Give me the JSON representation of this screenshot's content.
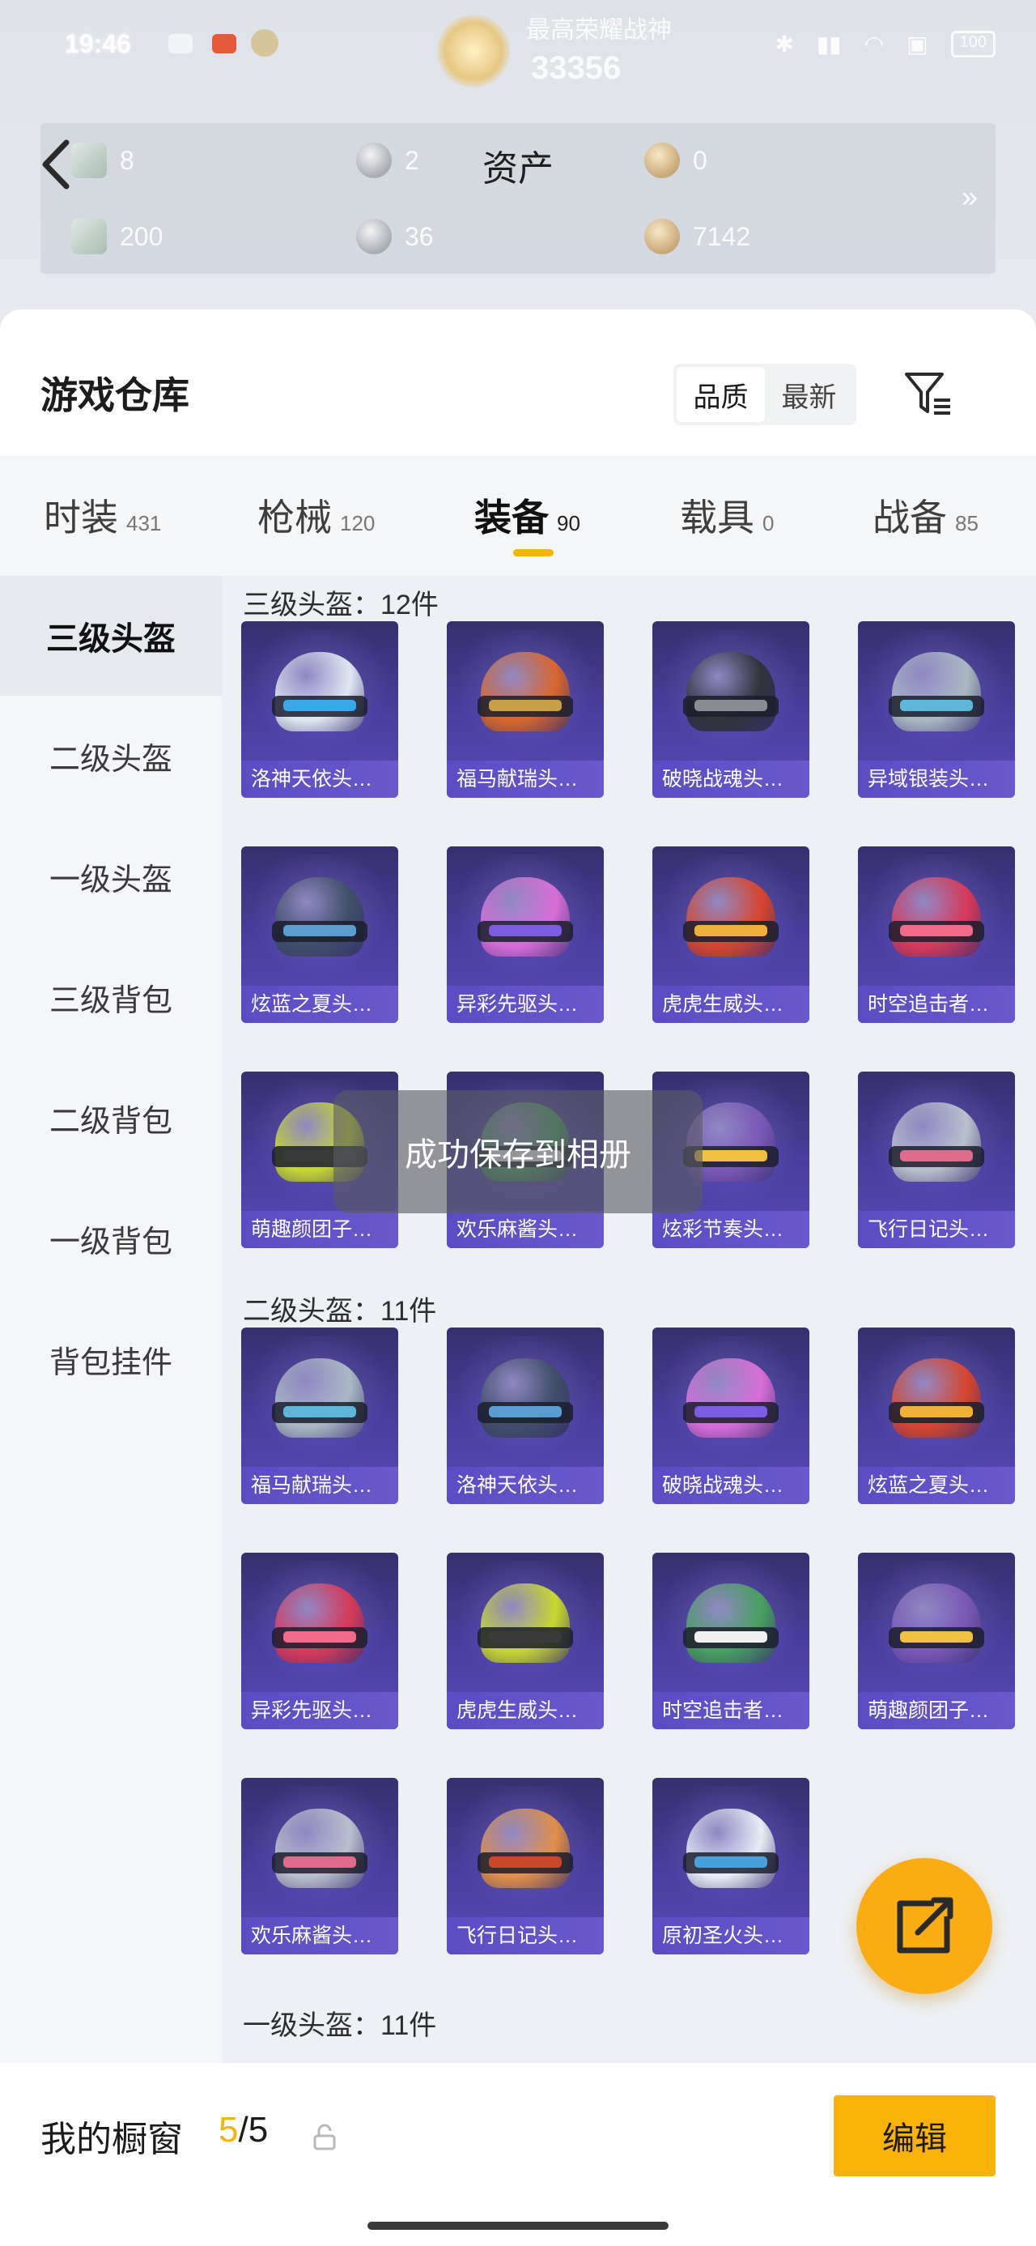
{
  "status_bar": {
    "time": "19:46",
    "battery": "100"
  },
  "rank": {
    "label": "最高荣耀战神",
    "points": "33356"
  },
  "assets": {
    "title": "资产",
    "items": [
      {
        "value": "8",
        "icon": "gem-icon"
      },
      {
        "value": "2",
        "icon": "token-icon"
      },
      {
        "value": "0",
        "icon": "gold-coin-icon"
      },
      {
        "value": "200",
        "icon": "ticket-icon"
      },
      {
        "value": "36",
        "icon": "silver-coin-icon"
      },
      {
        "value": "7142",
        "icon": "bronze-coin-icon"
      }
    ]
  },
  "warehouse": {
    "title": "游戏仓库",
    "sort": {
      "options": [
        "品质",
        "最新"
      ],
      "selected": "品质"
    }
  },
  "tabs": [
    {
      "label": "时装",
      "count": "431",
      "active": false
    },
    {
      "label": "枪械",
      "count": "120",
      "active": false
    },
    {
      "label": "装备",
      "count": "90",
      "active": true
    },
    {
      "label": "载具",
      "count": "0",
      "active": false
    },
    {
      "label": "战备",
      "count": "85",
      "active": false
    }
  ],
  "categories": [
    {
      "label": "三级头盔",
      "active": true
    },
    {
      "label": "二级头盔",
      "active": false
    },
    {
      "label": "一级头盔",
      "active": false
    },
    {
      "label": "三级背包",
      "active": false
    },
    {
      "label": "二级背包",
      "active": false
    },
    {
      "label": "一级背包",
      "active": false
    },
    {
      "label": "背包挂件",
      "active": false
    }
  ],
  "sections": [
    {
      "title": "三级头盔：12件",
      "items": [
        "洛神天依头…",
        "福马献瑞头…",
        "破晓战魂头…",
        "异域银装头…",
        "炫蓝之夏头…",
        "异彩先驱头…",
        "虎虎生威头…",
        "时空追击者…",
        "萌趣颜团子…",
        "欢乐麻酱头…",
        "炫彩节奏头…",
        "飞行日记头…"
      ]
    },
    {
      "title": "二级头盔：11件",
      "items": [
        "福马献瑞头…",
        "洛神天依头…",
        "破晓战魂头…",
        "炫蓝之夏头…",
        "异彩先驱头…",
        "虎虎生威头…",
        "时空追击者…",
        "萌趣颜团子…",
        "欢乐麻酱头…",
        "飞行日记头…",
        "原初圣火头…"
      ]
    },
    {
      "title": "一级头盔：11件",
      "items": []
    }
  ],
  "toast": "成功保存到相册",
  "showcase": {
    "label": "我的橱窗",
    "used": "5",
    "sep": "/",
    "total": "5",
    "edit_label": "编辑"
  },
  "colors": {
    "accent": "#f5b400",
    "card_bg": "#4a3fa0",
    "fab": "#f9ad12"
  }
}
